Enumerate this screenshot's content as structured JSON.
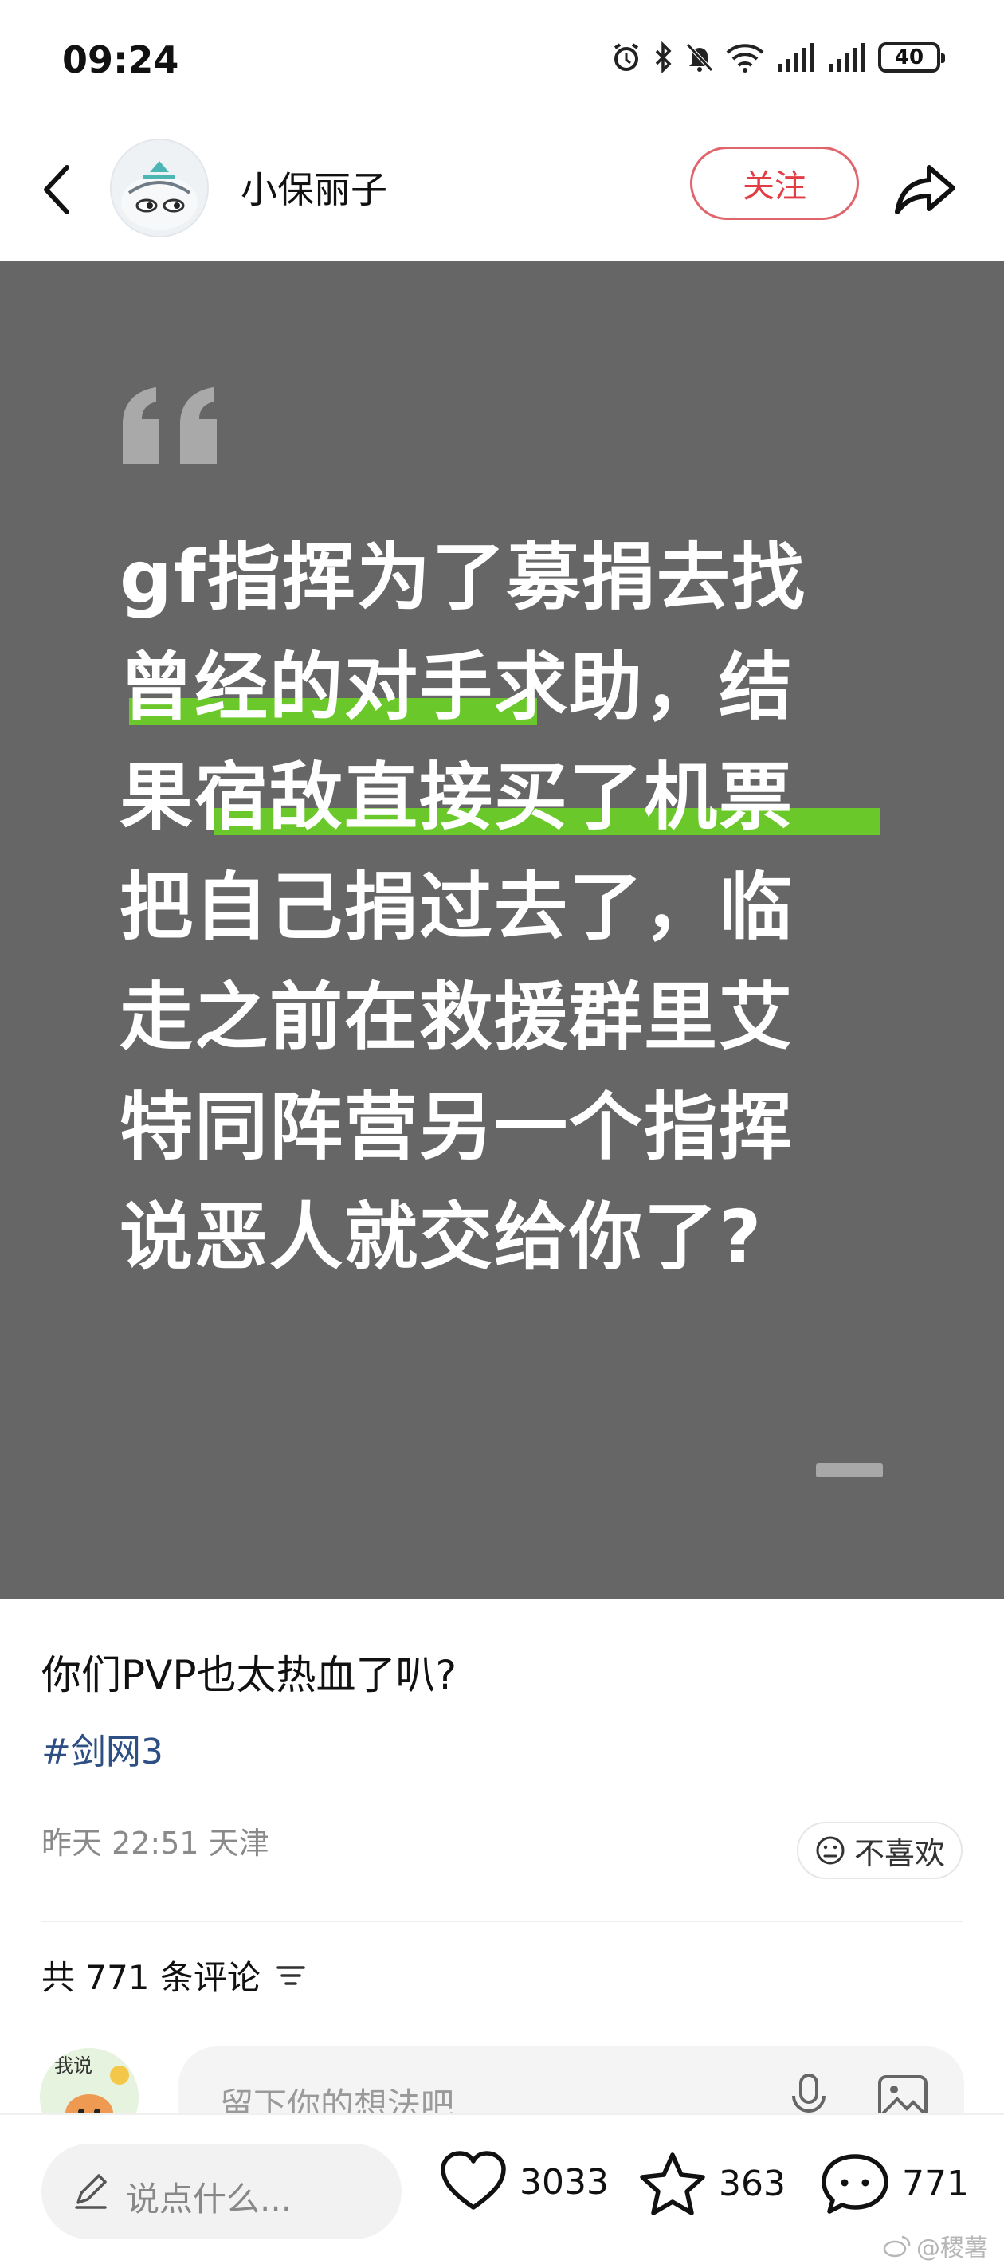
{
  "status_bar": {
    "time": "09:24",
    "battery": "40",
    "icons": [
      "alarm-icon",
      "bluetooth-icon",
      "mute-icon",
      "wifi-icon",
      "signal-icon",
      "signal-icon"
    ]
  },
  "header": {
    "username": "小保丽子",
    "follow_label": "关注",
    "back_icon": "back-arrow-icon",
    "share_icon": "share-icon"
  },
  "quote_card": {
    "background": "#666666",
    "highlight_color": "#6bc82a",
    "lines": [
      "gf指挥为了募捐去找",
      "曾经的对手求助，结",
      "果宿敌直接买了机票",
      "把自己捐过去了，临",
      "走之前在救援群里艾",
      "特同阵营另一个指挥",
      "说恶人就交给你了?"
    ]
  },
  "post": {
    "title": "你们PVP也太热血了叭?",
    "tag": "#剑网3",
    "meta": "昨天 22:51 天津",
    "dislike_label": "不喜欢"
  },
  "comments": {
    "count_label": "共 771 条评论",
    "input_placeholder": "留下你的想法吧"
  },
  "bottom_bar": {
    "say_placeholder": "说点什么...",
    "likes": "3033",
    "favorites": "363",
    "comments": "771",
    "watermark": "@稷薯"
  },
  "colors": {
    "accent_red": "#e23d45",
    "tag_blue": "#2d4f84"
  }
}
